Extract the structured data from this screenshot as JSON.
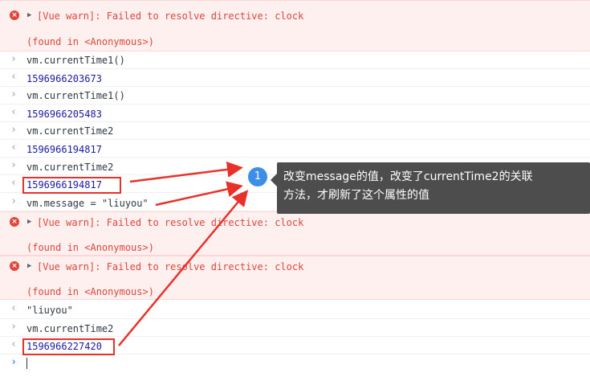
{
  "console": {
    "warn_text": "[Vue warn]: Failed to resolve directive: clock",
    "found_text": "(found in <Anonymous>)",
    "entries": [
      {
        "cmd": "vm.currentTime1()",
        "result": "1596966203673"
      },
      {
        "cmd": "vm.currentTime1()",
        "result": "1596966205483"
      },
      {
        "cmd": "vm.currentTime2",
        "result": "1596966194817"
      },
      {
        "cmd": "vm.currentTime2",
        "result": "1596966194817"
      }
    ],
    "message_cmd": "vm.message = \"liuyou\"",
    "message_result": "\"liuyou\"",
    "final_cmd": "vm.currentTime2",
    "final_result": "1596966227420"
  },
  "annotation": {
    "badge": "1",
    "line1": "改变message的值，改变了currentTime2的关联",
    "line2": "方法，才刷新了这个属性的值"
  },
  "icons": {
    "input_prompt": "chevron-right-icon",
    "output_prompt": "return-arrow-icon",
    "error": "error-circle-icon",
    "expand": "expand-triangle-icon"
  },
  "colors": {
    "error_bg": "#fff0f0",
    "error_text": "#e0453a",
    "number_text": "#1a1aa6",
    "highlight": "#e8312b",
    "tooltip_bg": "#4d4d4d",
    "badge_bg": "#3d8ee6"
  }
}
